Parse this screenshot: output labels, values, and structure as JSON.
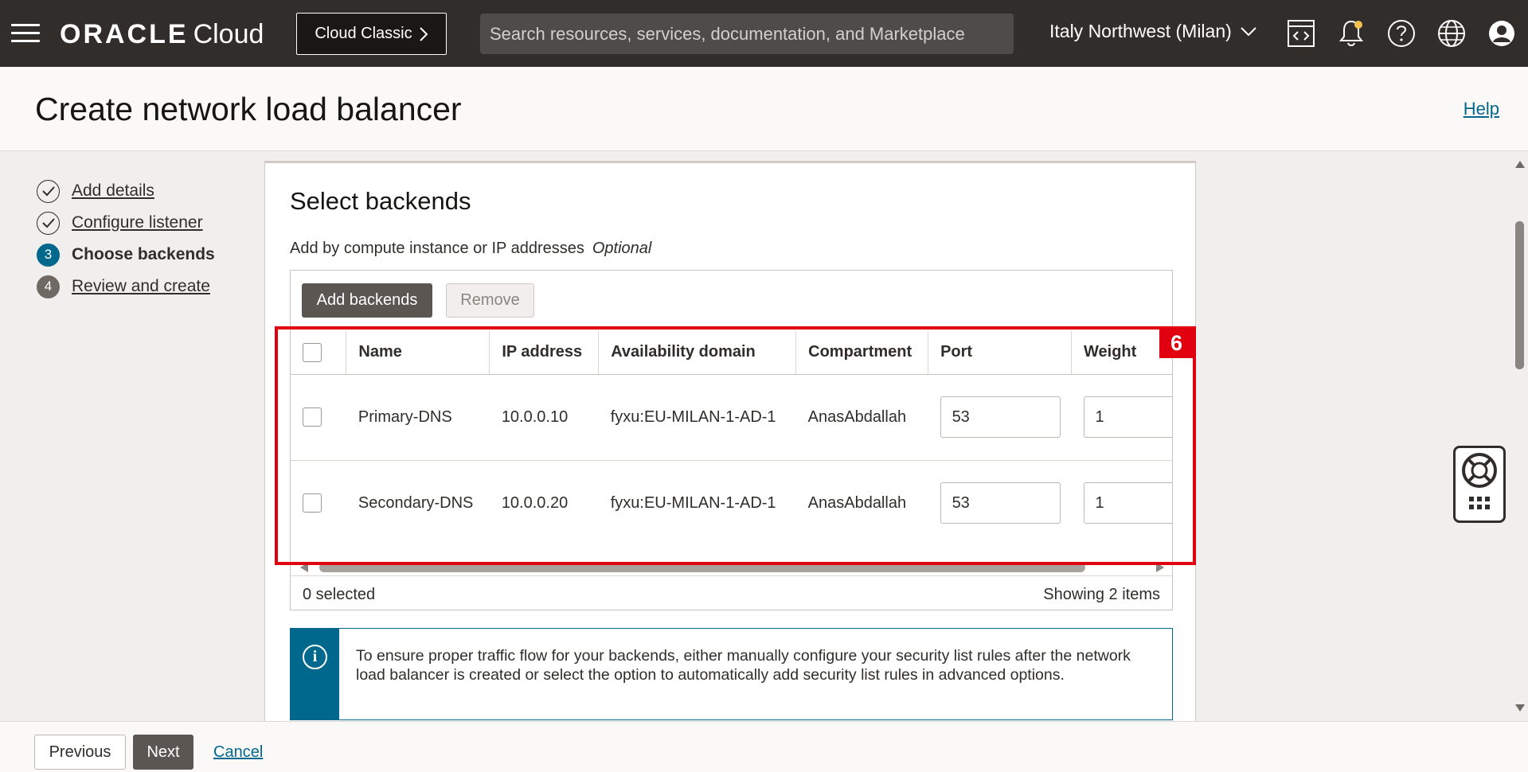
{
  "topbar": {
    "brand_oracle": "ORACLE",
    "brand_cloud": "Cloud",
    "classic_button": "Cloud Classic",
    "search_placeholder": "Search resources, services, documentation, and Marketplace",
    "region": "Italy Northwest (Milan)",
    "icons": [
      "menu-icon",
      "code-editor-icon",
      "bell-icon",
      "help-icon",
      "globe-icon",
      "user-icon"
    ]
  },
  "header": {
    "title": "Create network load balancer",
    "help": "Help"
  },
  "steps": [
    {
      "num": "",
      "label": "Add details",
      "status": "done"
    },
    {
      "num": "",
      "label": "Configure listener",
      "status": "done"
    },
    {
      "num": "3",
      "label": "Choose backends",
      "status": "current"
    },
    {
      "num": "4",
      "label": "Review and create",
      "status": "todo"
    }
  ],
  "section": {
    "title": "Select backends",
    "sublabel": "Add by compute instance or IP addresses",
    "optional": "Optional"
  },
  "toolbar": {
    "add_label": "Add backends",
    "remove_label": "Remove"
  },
  "table": {
    "columns": [
      "Name",
      "IP address",
      "Availability domain",
      "Compartment",
      "Port",
      "Weight"
    ],
    "rows": [
      {
        "name": "Primary-DNS",
        "ip": "10.0.0.10",
        "ad": "fyxu:EU-MILAN-1-AD-1",
        "compartment": "AnasAbdallah",
        "port": "53",
        "weight": "1"
      },
      {
        "name": "Secondary-DNS",
        "ip": "10.0.0.20",
        "ad": "fyxu:EU-MILAN-1-AD-1",
        "compartment": "AnasAbdallah",
        "port": "53",
        "weight": "1"
      }
    ],
    "selected": "0 selected",
    "count": "Showing 2 items"
  },
  "info": {
    "text": "To ensure proper traffic flow for your backends, either manually configure your security list rules after the network load balancer is created or select the option to automatically add security list rules in advanced options."
  },
  "annotation": {
    "badge": "6",
    "color": "#e00010"
  },
  "footer": {
    "previous": "Previous",
    "next": "Next",
    "cancel": "Cancel"
  },
  "colors": {
    "topbar": "#312d2a",
    "accent": "#00688c",
    "primary_button": "#5b5652"
  }
}
